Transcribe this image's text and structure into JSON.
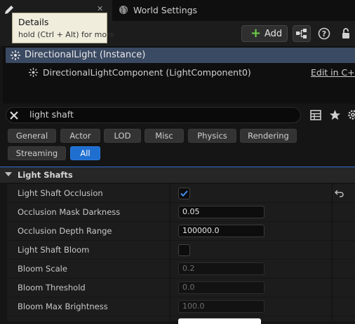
{
  "tabs": {
    "details_label": "Details",
    "world_settings_label": "World Settings"
  },
  "tooltip": {
    "title": "Details",
    "subtitle": "hold (Ctrl + Alt) for more"
  },
  "toolbar": {
    "add_label": "Add"
  },
  "tree": {
    "actor_label": "DirectionalLight (Instance)",
    "component_label": "DirectionalLightComponent (LightComponent0)",
    "edit_link": "Edit in C++"
  },
  "search": {
    "value": "light shaft"
  },
  "filters": {
    "general": "General",
    "actor": "Actor",
    "lod": "LOD",
    "misc": "Misc",
    "physics": "Physics",
    "rendering": "Rendering",
    "streaming": "Streaming",
    "all": "All"
  },
  "section": {
    "title": "Light Shafts"
  },
  "properties": {
    "occlusion": {
      "label": "Light Shaft Occlusion",
      "checked": true
    },
    "mask_darkness": {
      "label": "Occlusion Mask Darkness",
      "value": "0.05",
      "fill": 0.05
    },
    "depth_range": {
      "label": "Occlusion Depth Range",
      "value": "100000.0"
    },
    "bloom": {
      "label": "Light Shaft Bloom",
      "checked": false
    },
    "bloom_scale": {
      "label": "Bloom Scale",
      "value": "0.2"
    },
    "bloom_threshold": {
      "label": "Bloom Threshold",
      "value": "0.0"
    },
    "bloom_max_brightness": {
      "label": "Bloom Max Brightness",
      "value": "100.0"
    }
  },
  "colors": {
    "accent": "#1f6fd1",
    "selection": "#3b4a63",
    "add_plus": "#6ccf4a"
  }
}
